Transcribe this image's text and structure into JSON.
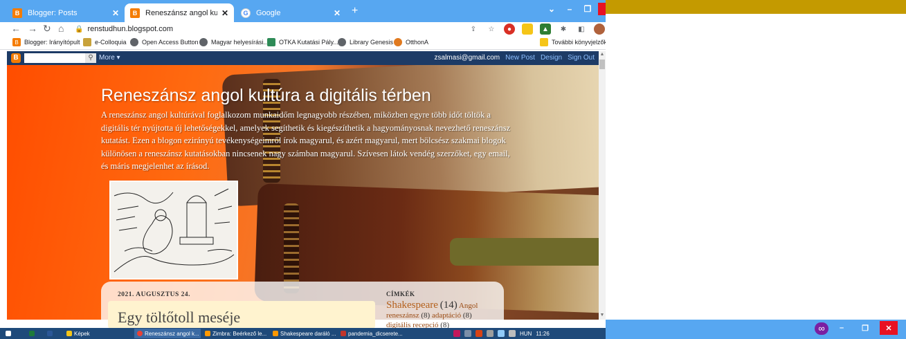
{
  "browser": {
    "tabs": [
      {
        "title": "Blogger: Posts",
        "icon": "blogger-icon",
        "active": false
      },
      {
        "title": "Reneszánsz angol kultúra a digitá",
        "icon": "blogger-icon",
        "active": true
      },
      {
        "title": "Google",
        "icon": "google-icon",
        "active": false
      }
    ],
    "new_tab": "+",
    "url": "renstudhun.blogspot.com",
    "bookmarks": [
      {
        "label": "Blogger: Irányítópult",
        "icon": "blogger-icon"
      },
      {
        "label": "e-Colloquia",
        "icon": "folder-icon"
      },
      {
        "label": "Open Access Button",
        "icon": "globe-icon"
      },
      {
        "label": "Magyar helyesírási...",
        "icon": "globe-icon"
      },
      {
        "label": "OTKA Kutatási Pály...",
        "icon": "otka-icon"
      },
      {
        "label": "Library Genesis",
        "icon": "globe-icon"
      },
      {
        "label": "OtthonA",
        "icon": "home-icon"
      }
    ],
    "other_bookmarks": "További könyvjelzők"
  },
  "navbar": {
    "logo": "B",
    "more": "More ▾",
    "email": "zsalmasi@gmail.com",
    "new_post": "New Post",
    "design": "Design",
    "sign_out": "Sign Out"
  },
  "blog": {
    "title": "Reneszánsz angol kultúra a digitális térben",
    "description": "A reneszánsz angol kultúrával foglalkozom munkaidőm legnagyobb részében, miközben egyre több időt töltök a digitális tér nyújtotta új lehetőségekkel, amelyek segíthetik és kiegészíthetik a hagyományosnak nevezhető reneszánsz kutatást. Ezen a blogon ezirányú tevékenységeimről írok magyarul, és azért magyarul, mert bölcsész szakmai blogok különösen a reneszánsz kutatásokban nincsenek nagy számban magyarul. Szívesen látok vendég szerzőket, egy email, és máris megjelenhet az írásod.",
    "post_date": "2021. AUGUSZTUS 24.",
    "post_title": "Egy töltőtoll meséje",
    "labels_heading": "CÍMKÉK",
    "labels": [
      {
        "name": "Shakespeare",
        "count": "(14)",
        "big": true
      },
      {
        "name": "Angol reneszánsz",
        "count": "(8)",
        "big": false
      },
      {
        "name": "adaptáció",
        "count": "(8)",
        "big": false
      },
      {
        "name": "digitális",
        "count": "",
        "big": false
      },
      {
        "name": "recepció",
        "count": "(8)",
        "big": false
      }
    ]
  },
  "taskbar": {
    "items": [
      {
        "label": "Képek"
      },
      {
        "label": "Reneszánsz angol k..."
      },
      {
        "label": "Zimbra: Beérkező le..."
      },
      {
        "label": "Shakespeare daráló ..."
      },
      {
        "label": "pandemia_dicserete..."
      }
    ],
    "lang": "HUN",
    "time": "11:26"
  },
  "colors": {
    "tabbar": "#57a7f1",
    "gold": "#c49a00",
    "navbar": "#1d3b66",
    "close": "#e81123"
  }
}
